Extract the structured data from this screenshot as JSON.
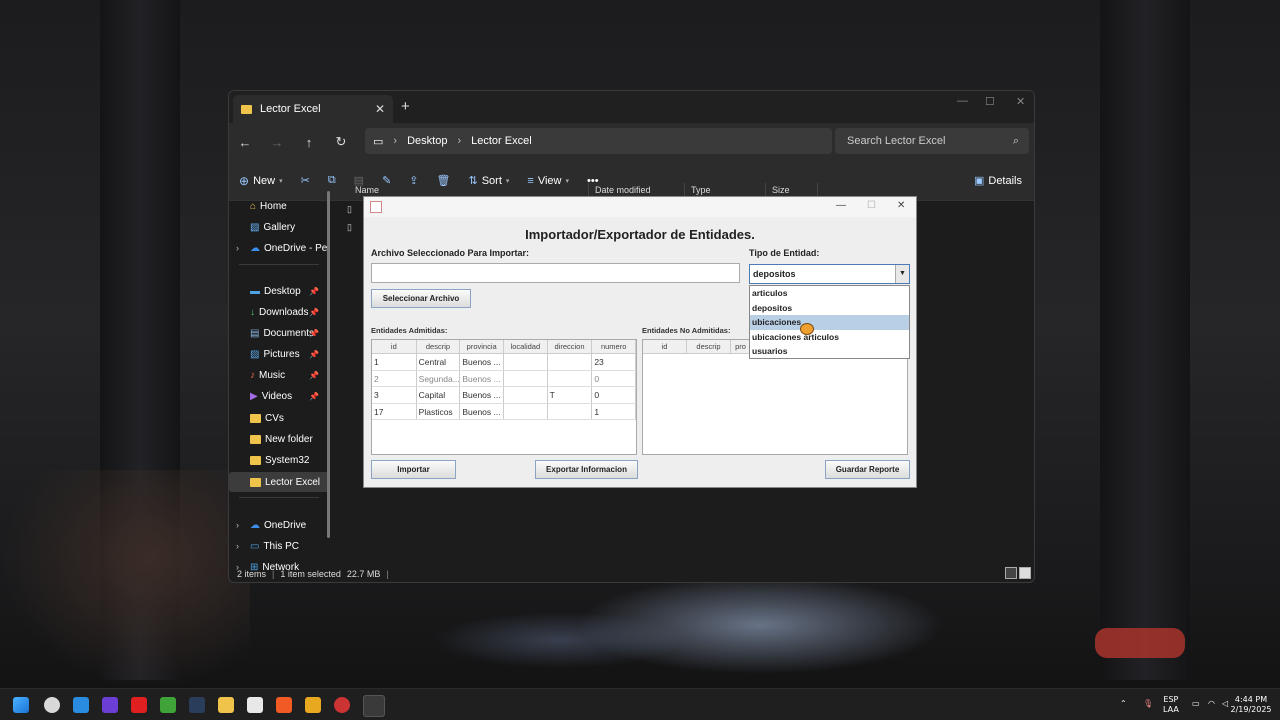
{
  "explorer": {
    "tab_title": "Lector Excel",
    "tab_close": "✕",
    "new_tab": "+",
    "breadcrumb": [
      "Desktop",
      "Lector Excel"
    ],
    "search_placeholder": "Search Lector Excel",
    "toolbar": {
      "new": "New",
      "sort": "Sort",
      "view": "View",
      "more": "•••",
      "details": "Details"
    },
    "sidebar": [
      {
        "label": "Home",
        "icon": "home-icon"
      },
      {
        "label": "Gallery",
        "icon": "gallery-icon"
      },
      {
        "label": "OneDrive - Pers",
        "icon": "cloud-icon"
      },
      {
        "label": "Desktop",
        "icon": "desktop-icon"
      },
      {
        "label": "Downloads",
        "icon": "download-icon"
      },
      {
        "label": "Documents",
        "icon": "document-icon"
      },
      {
        "label": "Pictures",
        "icon": "picture-icon"
      },
      {
        "label": "Music",
        "icon": "music-icon"
      },
      {
        "label": "Videos",
        "icon": "video-icon"
      },
      {
        "label": "CVs",
        "icon": "folder-icon"
      },
      {
        "label": "New folder",
        "icon": "folder-icon"
      },
      {
        "label": "System32",
        "icon": "folder-icon"
      },
      {
        "label": "Lector Excel",
        "icon": "folder-icon",
        "selected": true
      },
      {
        "label": "OneDrive",
        "icon": "cloud-icon"
      },
      {
        "label": "This PC",
        "icon": "pc-icon"
      },
      {
        "label": "Network",
        "icon": "network-icon"
      }
    ],
    "columns": [
      "Name",
      "Date modified",
      "Type",
      "Size"
    ],
    "status": {
      "items": "2 items",
      "selected": "1 item selected",
      "size": "22.7 MB"
    }
  },
  "dialog": {
    "heading": "Importador/Exportador de Entidades.",
    "file_label": "Archivo Seleccionado Para Importar:",
    "file_value": "",
    "type_label": "Tipo de Entidad:",
    "type_value": "depositos",
    "select_button": "Seleccionar Archivo",
    "admitted_label": "Entidades Admitidas:",
    "not_admitted_label": "Entidades No Admitidas:",
    "admitted_columns": [
      "id",
      "descrip",
      "provincia",
      "localidad",
      "direccion",
      "numero"
    ],
    "admitted_rows": [
      [
        "1",
        "Central",
        "Buenos ...",
        "",
        "",
        "23"
      ],
      [
        "2",
        "Segunda...",
        "Buenos ...",
        "",
        "",
        "0"
      ],
      [
        "3",
        "Capital",
        "Buenos ...",
        "",
        "T",
        "0"
      ],
      [
        "17",
        "Plasticos",
        "Buenos ...",
        "",
        "",
        "1"
      ]
    ],
    "not_admitted_columns": [
      "id",
      "descrip",
      "pro"
    ],
    "dropdown_options": [
      "articulos",
      "depositos",
      "ubicaciones",
      "ubicaciones articulos",
      "usuarios"
    ],
    "dropdown_highlighted": 2,
    "import_button": "Importar",
    "export_button": "Exportar Informacion",
    "report_button": "Guardar Reporte"
  },
  "tray": {
    "lang_top": "ESP",
    "lang_bottom": "LAA",
    "time": "4:44 PM",
    "date": "2/19/2025"
  }
}
